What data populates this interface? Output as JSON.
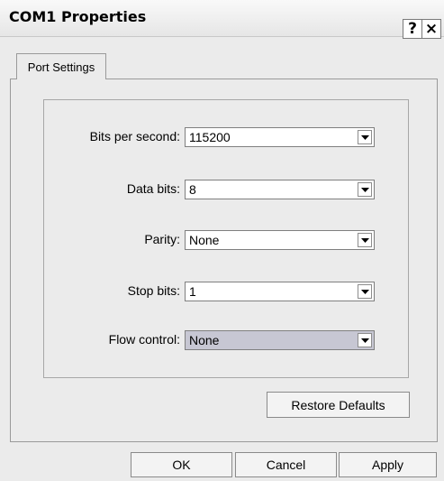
{
  "window": {
    "title": "COM1 Properties",
    "help_label": "?",
    "close_label": "×"
  },
  "tabs": [
    {
      "label": "Port Settings",
      "selected": true
    }
  ],
  "fields": [
    {
      "label": "Bits per second:",
      "value": "115200"
    },
    {
      "label": "Data bits:",
      "value": "8"
    },
    {
      "label": "Parity:",
      "value": "None"
    },
    {
      "label": "Stop bits:",
      "value": "1"
    },
    {
      "label": "Flow control:",
      "value": "None"
    }
  ],
  "buttons": {
    "restore_defaults": "Restore Defaults",
    "ok": "OK",
    "cancel": "Cancel",
    "apply": "Apply"
  }
}
